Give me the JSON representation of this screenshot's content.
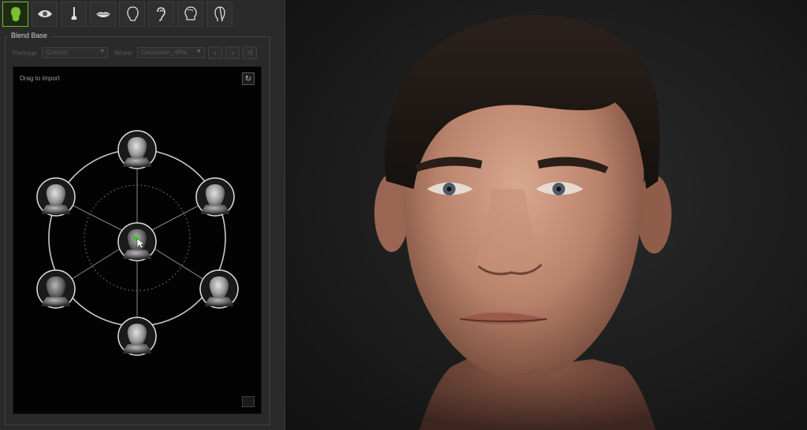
{
  "toolbar": {
    "tools": [
      {
        "icon": "head-icon",
        "active": true
      },
      {
        "icon": "eye-icon",
        "active": false
      },
      {
        "icon": "nose-icon",
        "active": false
      },
      {
        "icon": "mouth-icon",
        "active": false
      },
      {
        "icon": "jaw-icon",
        "active": false
      },
      {
        "icon": "ear-icon",
        "active": false
      },
      {
        "icon": "skull-icon",
        "active": false
      },
      {
        "icon": "face-outline-icon",
        "active": false
      }
    ]
  },
  "blend": {
    "title": "Blend Base",
    "package_label": "Package",
    "package_value": "Custom",
    "wheel_label": "Wheel",
    "wheel_value": "Caucasian_4Pla",
    "drag_label": "Drag to import",
    "center_face": "center-face",
    "faces": [
      "face-top",
      "face-upper-right",
      "face-lower-right",
      "face-bottom",
      "face-lower-left",
      "face-upper-left"
    ]
  },
  "colors": {
    "accent": "#6fba2c",
    "panel": "#2a2a2a",
    "wheel_bg": "#030303"
  }
}
